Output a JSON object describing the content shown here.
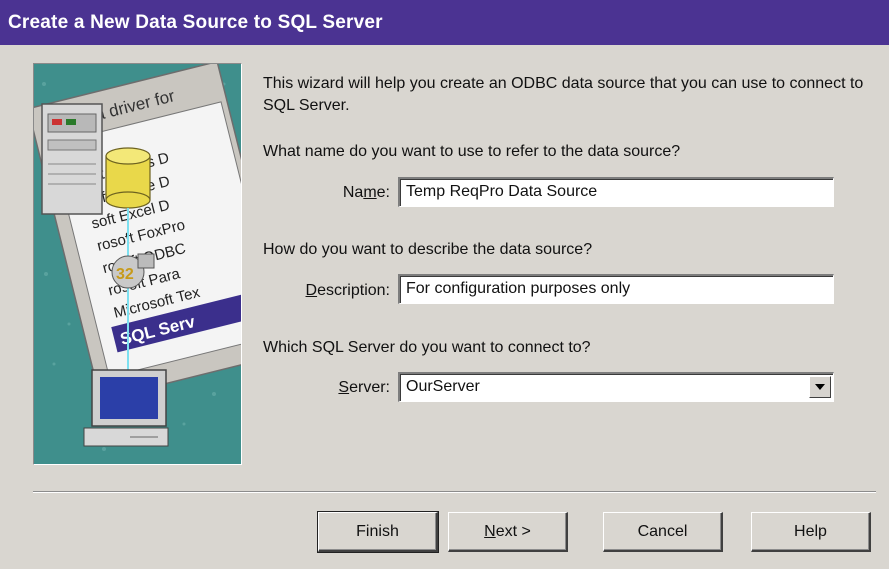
{
  "window": {
    "title": "Create a New Data Source to SQL Server"
  },
  "illustration": {
    "header_text": "Select a driver for",
    "drivers": [
      "me",
      "soft Access D",
      "soft dBase D",
      "soft Excel D",
      "rosoft FoxPro",
      "rosoft ODBC",
      "rosoft Para",
      "Microsoft Tex",
      "SQL Serv"
    ],
    "badge": "32"
  },
  "intro_text": "This wizard will help you create an ODBC data source that you can use to connect to SQL Server.",
  "name_section": {
    "question": "What name do you want to use to refer to the data source?",
    "label_pre": "Na",
    "label_ul": "m",
    "label_post": "e:",
    "value": "Temp ReqPro Data Source"
  },
  "description_section": {
    "question": "How do you want to describe the data source?",
    "label_pre": "",
    "label_ul": "D",
    "label_post": "escription:",
    "value": "For configuration purposes only"
  },
  "server_section": {
    "question": "Which SQL Server do you want to connect to?",
    "label_pre": "",
    "label_ul": "S",
    "label_post": "erver:",
    "value": "OurServer"
  },
  "buttons": {
    "finish": "Finish",
    "next_ul": "N",
    "next_rest": "ext >",
    "cancel": "Cancel",
    "help": "Help"
  }
}
